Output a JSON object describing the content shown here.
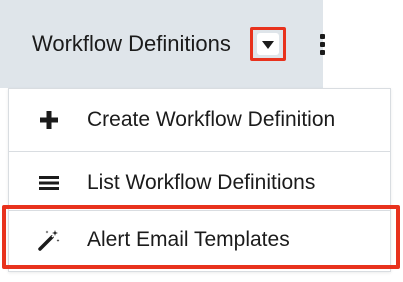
{
  "module": {
    "title": "Workflow Definitions",
    "caret_icon": "caret-down-icon",
    "more_icon": "vertical-ellipsis-icon"
  },
  "menu": {
    "items": [
      {
        "label": "Create Workflow Definition",
        "icon": "plus-icon"
      },
      {
        "label": "List Workflow Definitions",
        "icon": "list-icon"
      },
      {
        "label": "Alert Email Templates",
        "icon": "magic-wand-icon"
      }
    ]
  },
  "colors": {
    "topbar_bg": "#dfe5ea",
    "highlight_red": "#e8321d",
    "text": "#1b1b1b",
    "divider": "#d9dde1"
  }
}
